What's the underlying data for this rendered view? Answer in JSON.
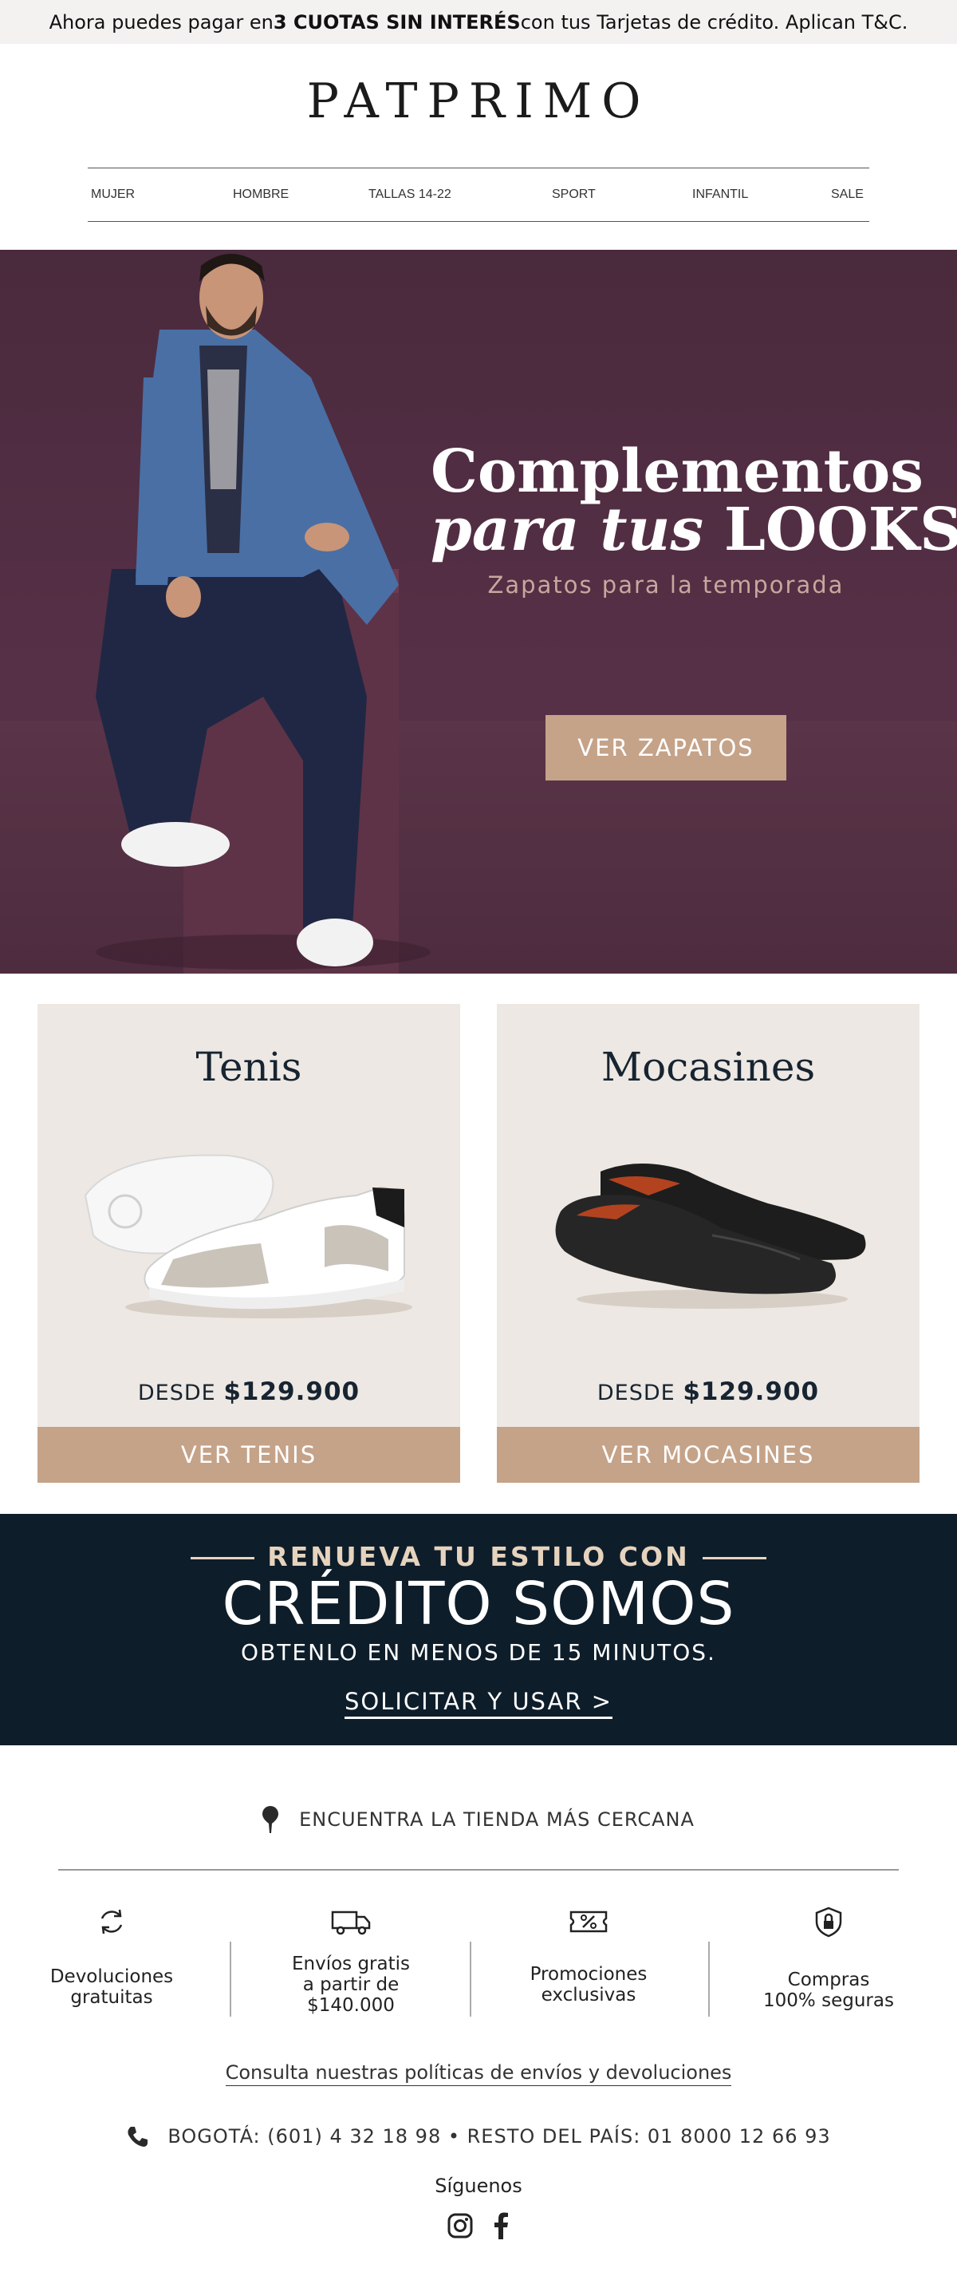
{
  "announcement": {
    "prefix": "Ahora puedes pagar en ",
    "bold": "3 CUOTAS SIN INTERÉS",
    "suffix": " con tus Tarjetas de crédito. Aplican T&C."
  },
  "brand": {
    "logo_text": "PATPRIMO"
  },
  "nav": {
    "items": [
      {
        "label": "MUJER"
      },
      {
        "label": "HOMBRE"
      },
      {
        "label": "TALLAS 14-22"
      },
      {
        "label": "SPORT"
      },
      {
        "label": "INFANTIL"
      },
      {
        "label": "SALE"
      }
    ]
  },
  "hero": {
    "title_line1": "Complementos",
    "title_italic": "para tus",
    "title_caps": "LOOKS",
    "subtitle": "Zapatos para la temporada",
    "button_label": "VER ZAPATOS"
  },
  "cards": [
    {
      "title": "Tenis",
      "price_prefix": "DESDE",
      "price": "$129.900",
      "button_label": "VER TENIS"
    },
    {
      "title": "Mocasines",
      "price_prefix": "DESDE",
      "price": "$129.900",
      "button_label": "VER MOCASINES"
    }
  ],
  "credit": {
    "pre_title": "RENUEVA TU ESTILO CON",
    "title": "CRÉDITO SOMOS",
    "subtitle": "OBTENLO EN MENOS DE 15 MINUTOS.",
    "link_label": "SOLICITAR Y USAR >"
  },
  "store_finder": {
    "label": "ENCUENTRA LA TIENDA MÁS CERCANA",
    "icon": "map-pin-icon"
  },
  "features": [
    {
      "icon": "refresh-icon",
      "line1": "Devoluciones",
      "line2": "gratuitas",
      "line3": ""
    },
    {
      "icon": "truck-icon",
      "line1": "Envíos gratis",
      "line2": "a partir de",
      "line3": "$140.000"
    },
    {
      "icon": "discount-ticket-icon",
      "line1": "Promociones",
      "line2": "exclusivas",
      "line3": ""
    },
    {
      "icon": "shield-lock-icon",
      "line1": "Compras",
      "line2": "100% seguras",
      "line3": ""
    }
  ],
  "policy_link": "Consulta nuestras políticas de envíos y devoluciones",
  "contact": {
    "phone_text": "BOGOTÁ: (601) 4 32 18 98 • RESTO DEL PAÍS: 01 8000 12 66 93",
    "icon": "phone-icon"
  },
  "social": {
    "label": "Síguenos",
    "icons": [
      "instagram-icon",
      "facebook-icon"
    ]
  },
  "colors": {
    "accent": "#c5a389",
    "navy": "#0e1d2a",
    "hero_bg": "#542f45",
    "card_bg": "#ede8e3"
  }
}
